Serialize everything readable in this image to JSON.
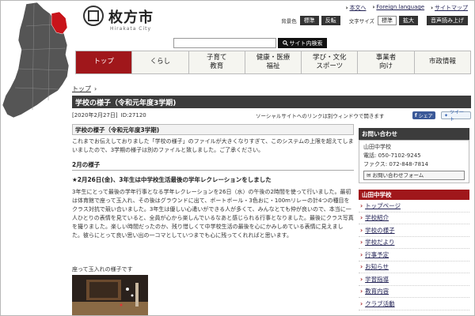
{
  "site": {
    "name": "枚方市",
    "name_roman": "Hirakata City"
  },
  "utility": {
    "links": [
      "本文へ",
      "Foreign language",
      "サイトマップ"
    ]
  },
  "access": {
    "bg_label": "背景色",
    "bg_normal": "標準",
    "bg_inverse": "反転",
    "text_label": "文字サイズ",
    "text_normal": "標準",
    "text_large": "拡大",
    "voice": "音声読み上げ"
  },
  "search": {
    "button": "サイト内検索"
  },
  "nav": [
    {
      "label": "トップ",
      "active": true
    },
    {
      "label": "くらし"
    },
    {
      "label": "子育て\n教育"
    },
    {
      "label": "健康・医療\n福祉"
    },
    {
      "label": "学び・文化\nスポーツ"
    },
    {
      "label": "事業者\n向け"
    },
    {
      "label": "市政情報"
    }
  ],
  "breadcrumb": [
    "トップ"
  ],
  "page": {
    "title": "学校の様子（令和元年度3学期)",
    "date": "[2020年2月27日]",
    "id": "ID:27120",
    "social_note": "ソーシャルサイトへのリンクは別ウィンドウで開きます",
    "share_fb": "シェア",
    "share_tw": "ツイート"
  },
  "content": {
    "section_heading": "学校の様子（令和元年度3学期)",
    "intro": "これまでお伝えしておりました「学校の様子」のファイルが大きくなりすぎて、このシステムの上限を超えてしまいましたので、3学期の様子は別のファイルと致しました。ご了承ください。",
    "month_heading": "2月の様子",
    "event_heading": "★2月26日(金)、3年生は中学校生活最後の学年レクレーションをしました",
    "event_body": "3年生にとって最後の学年行事となる学年レクレーションを26日（水）の午後の2時間を使って行いました。最初は体育館で座って玉入れ、その後はグラウンドに出て、ボートボール・3色おに・100mリレーの計4つの種目をクラス対抗で競い合いました。3年生は優しい心遣いができる人が多くて、みんなとても仲が良いので、本当に一人ひとりの表情を見ていると、全員が心から楽しんでいるなあと感じられる行事となりました。最後にクラス写真を撮りました。楽しい時間だったのか、残り惜しくて中学校生活の最後を心にかみしめている表情に見えました。彼らにとって良い思い出の一コマとしていつまでも心に残ってくれればと思います。",
    "photo_caption": "座って玉入れの様子です"
  },
  "contact": {
    "heading": "お問い合わせ",
    "org": "山田中学校",
    "tel": "電話: 050-7102-9245",
    "fax": "ファクス: 072-848-7814",
    "form": "お問い合わせフォーム"
  },
  "school_menu": {
    "heading": "山田中学校",
    "links": [
      "トップページ",
      "学校紹介",
      "学校の様子",
      "学校だより",
      "行事予定",
      "お知らせ",
      "学習指導",
      "教育内容",
      "クラブ活動"
    ]
  },
  "colors": {
    "brand": "#a0171b",
    "title_bar": "#3c3c3c"
  }
}
